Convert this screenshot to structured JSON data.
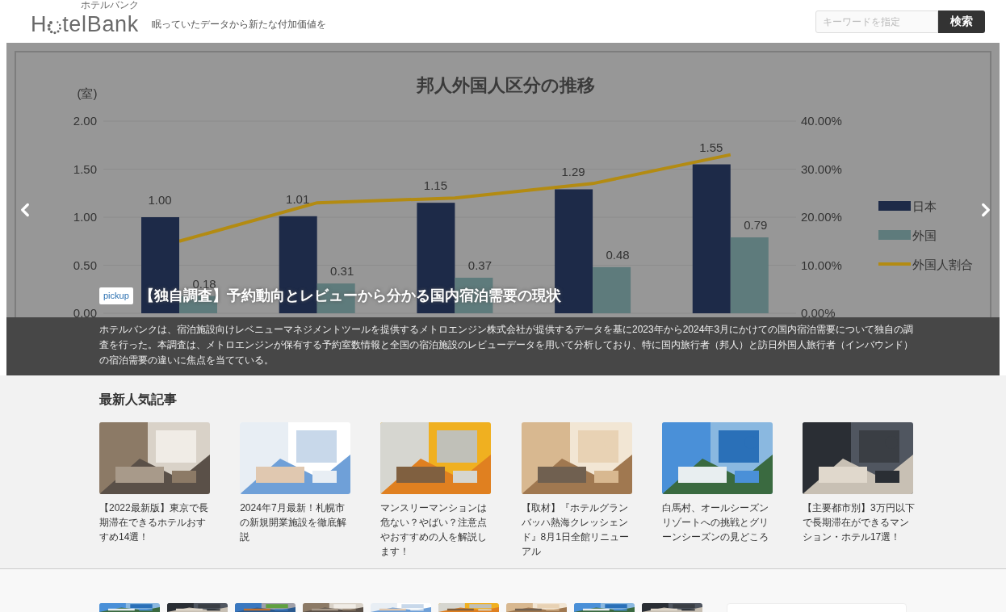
{
  "header": {
    "logo": {
      "ruby": "ホテルバンク",
      "before": "H",
      "after": "telBank"
    },
    "tagline": "眠っていたデータから新たな付加価値を",
    "search": {
      "placeholder": "キーワードを指定"
    },
    "search_button": "検索"
  },
  "hero": {
    "chart_data": {
      "type": "bar",
      "title": "邦人外国人区分の推移",
      "ylabel": "(室)",
      "ylim": [
        0,
        2
      ],
      "yticks": [
        {
          "value": 0,
          "label": "0.00"
        },
        {
          "value": 0.5,
          "label": "0.50"
        },
        {
          "value": 1,
          "label": "1.00"
        },
        {
          "value": 1.5,
          "label": "1.50"
        },
        {
          "value": 2,
          "label": "2.00"
        }
      ],
      "grid": true,
      "legend": true,
      "series": [
        {
          "name": "日本",
          "color": "#1d2a48",
          "values": [
            1.0,
            1.01,
            1.15,
            1.29,
            1.55
          ],
          "value_labels": [
            "1.00",
            "1.01",
            "1.15",
            "1.29",
            "1.55"
          ]
        },
        {
          "name": "外国",
          "color": "#5e7b7c",
          "values": [
            0.18,
            0.31,
            0.37,
            0.48,
            0.79
          ],
          "value_labels": [
            "0.18",
            "0.31",
            "0.37",
            "0.48",
            "0.79"
          ]
        }
      ]
    },
    "ratio_chart": {
      "chart_data": {
        "type": "line",
        "ylim": [
          0,
          0.4
        ],
        "yticks": [
          {
            "value": 0,
            "label": "0.00%"
          },
          {
            "value": 0.1,
            "label": "10.00%"
          },
          {
            "value": 0.2,
            "label": "20.00%"
          },
          {
            "value": 0.3,
            "label": "30.00%"
          },
          {
            "value": 0.4,
            "label": "40.00%"
          }
        ],
        "legend": true,
        "series": [
          {
            "name": "外国人割合",
            "color": "#b38b12",
            "values": [
              0.15,
              0.23,
              0.24,
              0.27,
              0.33
            ]
          }
        ]
      }
    },
    "badge": "pickup",
    "headline": "【独自調査】予約動向とレビューから分かる国内宿泊需要の現状",
    "summary": "ホテルバンクは、宿泊施設向けレベニューマネジメントツールを提供するメトロエンジン株式会社が提供するデータを基に2023年から2024年3月にかけての国内宿泊需要について独自の調査を行った。本調査は、メトロエンジンが保有する予約室数情報と全国の宿泊施設のレビューデータを用いて分析しており、特に国内旅行者（邦人）と訪日外国人旅行者（インバウンド）の宿泊需要の違いに焦点を当てている。"
  },
  "popular": {
    "title": "最新人気記事",
    "articles": [
      {
        "title": "【2022最新版】東京で長期滞在できるホテルおすすめ14選！",
        "kind": "picture"
      },
      {
        "title": "2024年7月最新！札幌市の新規開業施設を徹底解説",
        "kind": "picture"
      },
      {
        "title": "マンスリーマンションは危ない？やばい？注意点やおすすめの人を解説します！",
        "kind": "picture"
      },
      {
        "title": "【取材】『ホテルグランバッハ熱海クレッシェンド』8月1日全館リニューアル",
        "kind": "picture"
      },
      {
        "title": "白馬村、オールシーズンリゾートへの挑戦とグリーンシーズンの見どころ",
        "kind": "picture"
      },
      {
        "title": "【主要都市別】3万円以下で長期滞在ができるマンション・ホテル17選！",
        "kind": "picture"
      }
    ]
  }
}
